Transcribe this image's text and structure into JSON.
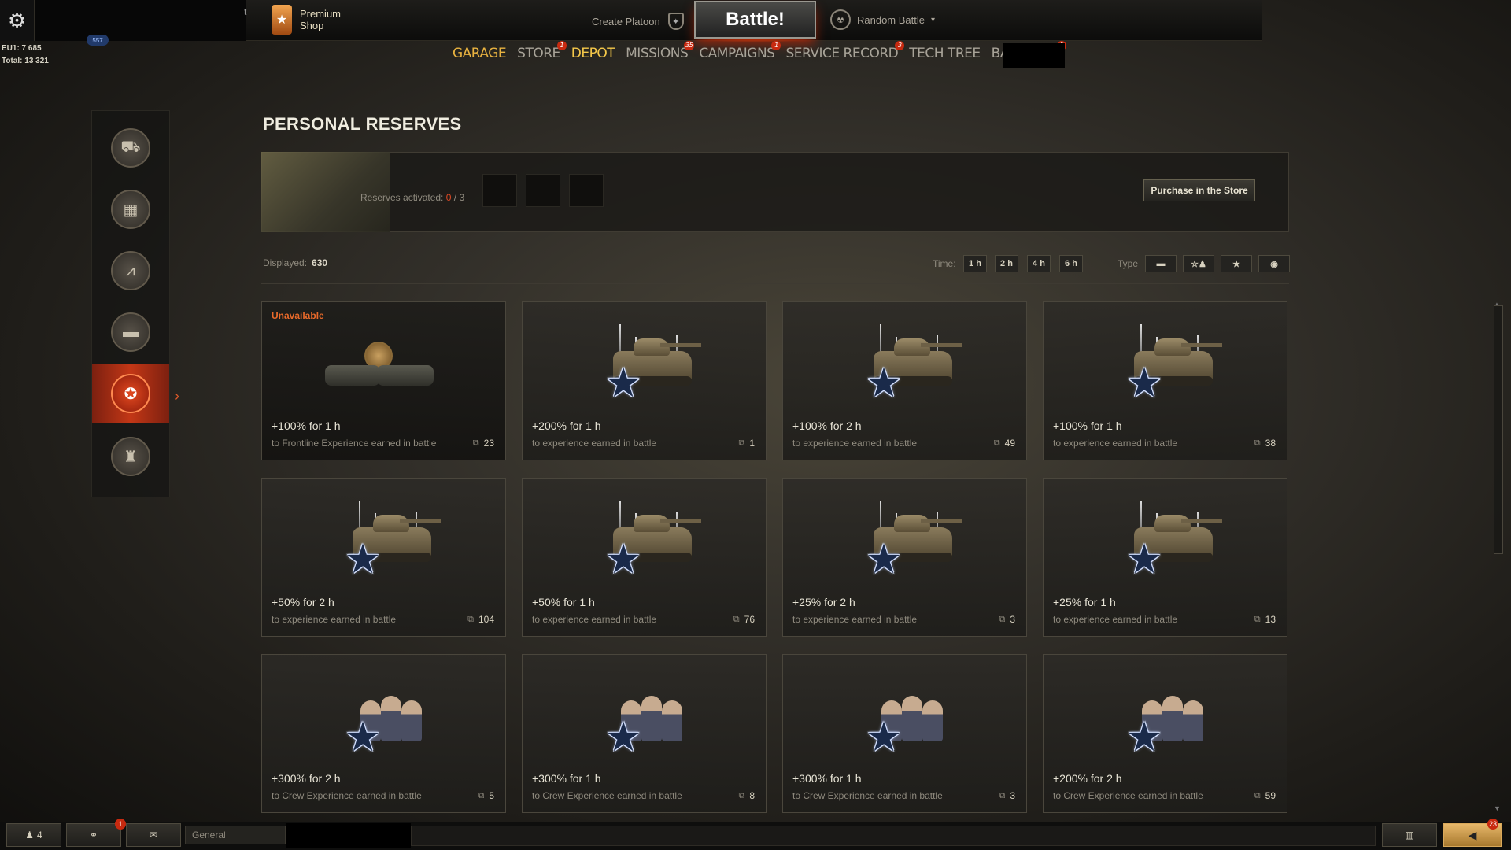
{
  "header": {
    "settings_icon": "gear-icon",
    "premium_shop": {
      "line1": "Premium",
      "line2": "Shop"
    },
    "create_platoon": "Create Platoon",
    "battle": "Battle!",
    "random_battle": "Random Battle",
    "partial_letter": "t",
    "xp_badge": "557"
  },
  "stats": {
    "eu1": "EU1: 7 685",
    "total": "Total: 13 321"
  },
  "nav": [
    {
      "label": "GARAGE",
      "badge": ""
    },
    {
      "label": "STORE",
      "badge": "1"
    },
    {
      "label": "DEPOT",
      "badge": ""
    },
    {
      "label": "MISSIONS",
      "badge": "35"
    },
    {
      "label": "CAMPAIGNS",
      "badge": "1"
    },
    {
      "label": "SERVICE RECORD",
      "badge": "3"
    },
    {
      "label": "TECH TREE",
      "badge": ""
    },
    {
      "label": "BARRACKS",
      "badge": "1"
    }
  ],
  "page_title": "PERSONAL RESERVES",
  "reserves": {
    "label": "Reserves activated:",
    "active": "0",
    "sep": " / ",
    "max": "3",
    "purchase": "Purchase in the Store"
  },
  "filters": {
    "displayed_label": "Displayed:",
    "displayed_value": "630",
    "time_label": "Time:",
    "times": [
      "1 h",
      "2 h",
      "4 h",
      "6 h"
    ],
    "type_label": "Type",
    "types": [
      "tank-icon",
      "crew-icon",
      "star-icon",
      "credits-icon"
    ]
  },
  "cards": [
    {
      "status": "Unavailable",
      "title": "+100% for 1 h",
      "desc": "to Frontline Experience earned in battle",
      "count": "23",
      "kind": "frontline"
    },
    {
      "status": "",
      "title": "+200% for 1 h",
      "desc": "to experience earned in battle",
      "count": "1",
      "kind": "tank"
    },
    {
      "status": "",
      "title": "+100% for 2 h",
      "desc": "to experience earned in battle",
      "count": "49",
      "kind": "tank"
    },
    {
      "status": "",
      "title": "+100% for 1 h",
      "desc": "to experience earned in battle",
      "count": "38",
      "kind": "tank"
    },
    {
      "status": "",
      "title": "+50% for 2 h",
      "desc": "to experience earned in battle",
      "count": "104",
      "kind": "tank"
    },
    {
      "status": "",
      "title": "+50% for 1 h",
      "desc": "to experience earned in battle",
      "count": "76",
      "kind": "tank"
    },
    {
      "status": "",
      "title": "+25% for 2 h",
      "desc": "to experience earned in battle",
      "count": "3",
      "kind": "tank"
    },
    {
      "status": "",
      "title": "+25% for 1 h",
      "desc": "to experience earned in battle",
      "count": "13",
      "kind": "tank"
    },
    {
      "status": "",
      "title": "+300% for 2 h",
      "desc": "to Crew Experience earned in battle",
      "count": "5",
      "kind": "crew"
    },
    {
      "status": "",
      "title": "+300% for 1 h",
      "desc": "to Crew Experience earned in battle",
      "count": "8",
      "kind": "crew"
    },
    {
      "status": "",
      "title": "+300% for 1 h",
      "desc": "to Crew Experience earned in battle",
      "count": "3",
      "kind": "crew"
    },
    {
      "status": "",
      "title": "+200% for 2 h",
      "desc": "to Crew Experience earned in battle",
      "count": "59",
      "kind": "crew"
    }
  ],
  "bottom": {
    "friends_count": "4",
    "clan_badge": "1",
    "channel": "General",
    "notif_badge": "23"
  }
}
